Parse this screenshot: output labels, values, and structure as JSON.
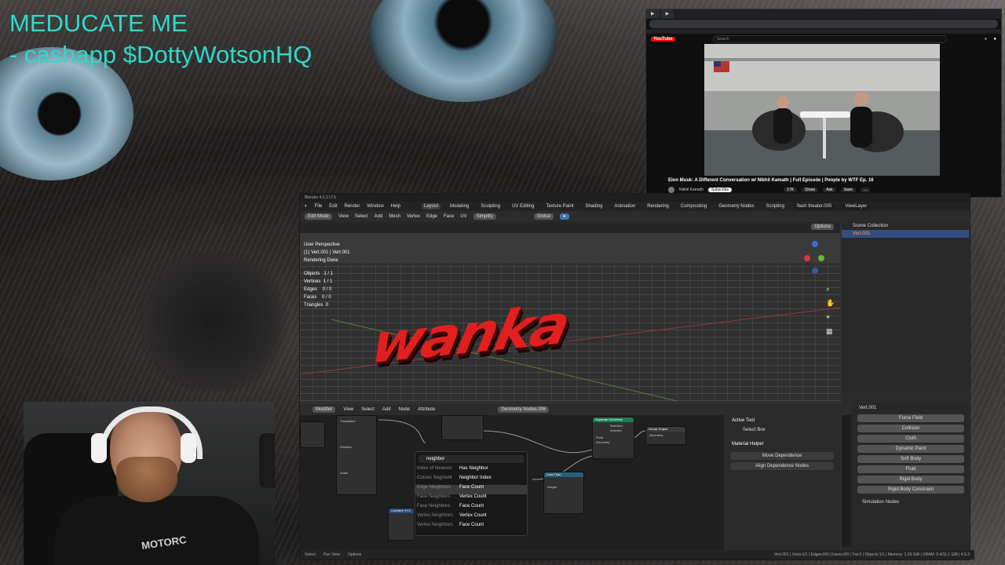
{
  "overlay": {
    "line1": "MEDUCATE ME",
    "line2": "- cashapp $DottyWotsonHQ"
  },
  "youtube": {
    "search_placeholder": "Search",
    "video_title": "Elon Musk: A Different Conversation w/ Nikhil Kamath | Full Episode | People by WTF Ep. 16",
    "channel": "Nikhil Kamath",
    "subscribe_label": "Subscribe",
    "actions": [
      "17K",
      "Share",
      "Ask",
      "Save",
      "..."
    ],
    "brand": "YouTube"
  },
  "blender": {
    "menu": [
      "File",
      "Edit",
      "Render",
      "Window",
      "Help"
    ],
    "workspaces": [
      "Layout",
      "Modeling",
      "Sculpting",
      "UV Editing",
      "Texture Paint",
      "Shading",
      "Animation",
      "Rendering",
      "Compositing",
      "Geometry Nodes",
      "Scripting"
    ],
    "scene": "flash theater.005",
    "view_layer": "ViewLayer",
    "viewport_header": [
      "Edit Mode",
      "View",
      "Select",
      "Add",
      "Mesh",
      "Vertex",
      "Edge",
      "Face",
      "UV"
    ],
    "simplify": "Simplify",
    "orientation": "Global",
    "options": "Options",
    "viewport_info": {
      "perspective": "User Perspective",
      "object": "(1) Vert.001 | Vert.001",
      "render": "Rendering Done",
      "stats": [
        {
          "label": "Objects",
          "value": "1 / 1"
        },
        {
          "label": "Vertices",
          "value": "1 / 1"
        },
        {
          "label": "Edges",
          "value": "0 / 0"
        },
        {
          "label": "Faces",
          "value": "0 / 0"
        },
        {
          "label": "Triangles",
          "value": "0"
        }
      ]
    },
    "viewport_text": "wanka",
    "outliner": {
      "title": "Scene Collection",
      "item": "Vert.001"
    },
    "properties": {
      "object": "Vert.001",
      "buttons": [
        "Force Field",
        "Collision",
        "Cloth",
        "Dynamic Paint",
        "Soft Body",
        "Fluid",
        "Rigid Body",
        "Rigid Body Constraint"
      ],
      "section": "Simulation Nodes"
    },
    "node_header": [
      "Modifier",
      "View",
      "Select",
      "Add",
      "Node",
      "Attribute"
    ],
    "node_tree": "Geometry Nodes.006",
    "search": {
      "query": "neighbor",
      "results": [
        {
          "a": "Index of Nearest",
          "b": "Has Neighbor"
        },
        {
          "a": "Curves Segment",
          "b": "Neighbor Index"
        },
        {
          "a": "Edge Neighbors",
          "b": "Face Count"
        },
        {
          "a": "Face Neighbors",
          "b": "Vertex Count"
        },
        {
          "a": "Face Neighbors",
          "b": "Face Count"
        },
        {
          "a": "Vertex Neighbors",
          "b": "Vertex Count"
        },
        {
          "a": "Vertex Neighbors",
          "b": "Face Count"
        }
      ]
    },
    "nodes": {
      "translation": "Translation",
      "rotation": "Rotation",
      "scale": "Scale",
      "separate": "Separate Geometry",
      "group_output": "Group Output",
      "less_than": "Less Than",
      "geometry": "Geometry",
      "selection": "Selection",
      "inverted": "Inverted",
      "point": "Point",
      "integer": "Integer",
      "combine": "Combine XYZ"
    },
    "side_panel": {
      "active_tool": "Active Tool",
      "select_box": "Select Box",
      "material_helper": "Material Helper",
      "move_dependence": "Move Dependence",
      "align_dependence": "Align Dependence Nodes"
    },
    "status": {
      "left": [
        "Select",
        "Pan View",
        "Options"
      ],
      "right": "Vert.001 | Verts:1/1 | Edges:0/0 | Faces:0/0 | Tris:0 | Objects:1/1 | Memory: 1.26 GiB | VRAM: 0.4/11.1 GiB | 4.5.2"
    }
  },
  "webcam": {
    "shirt_text": "MOTORC"
  }
}
